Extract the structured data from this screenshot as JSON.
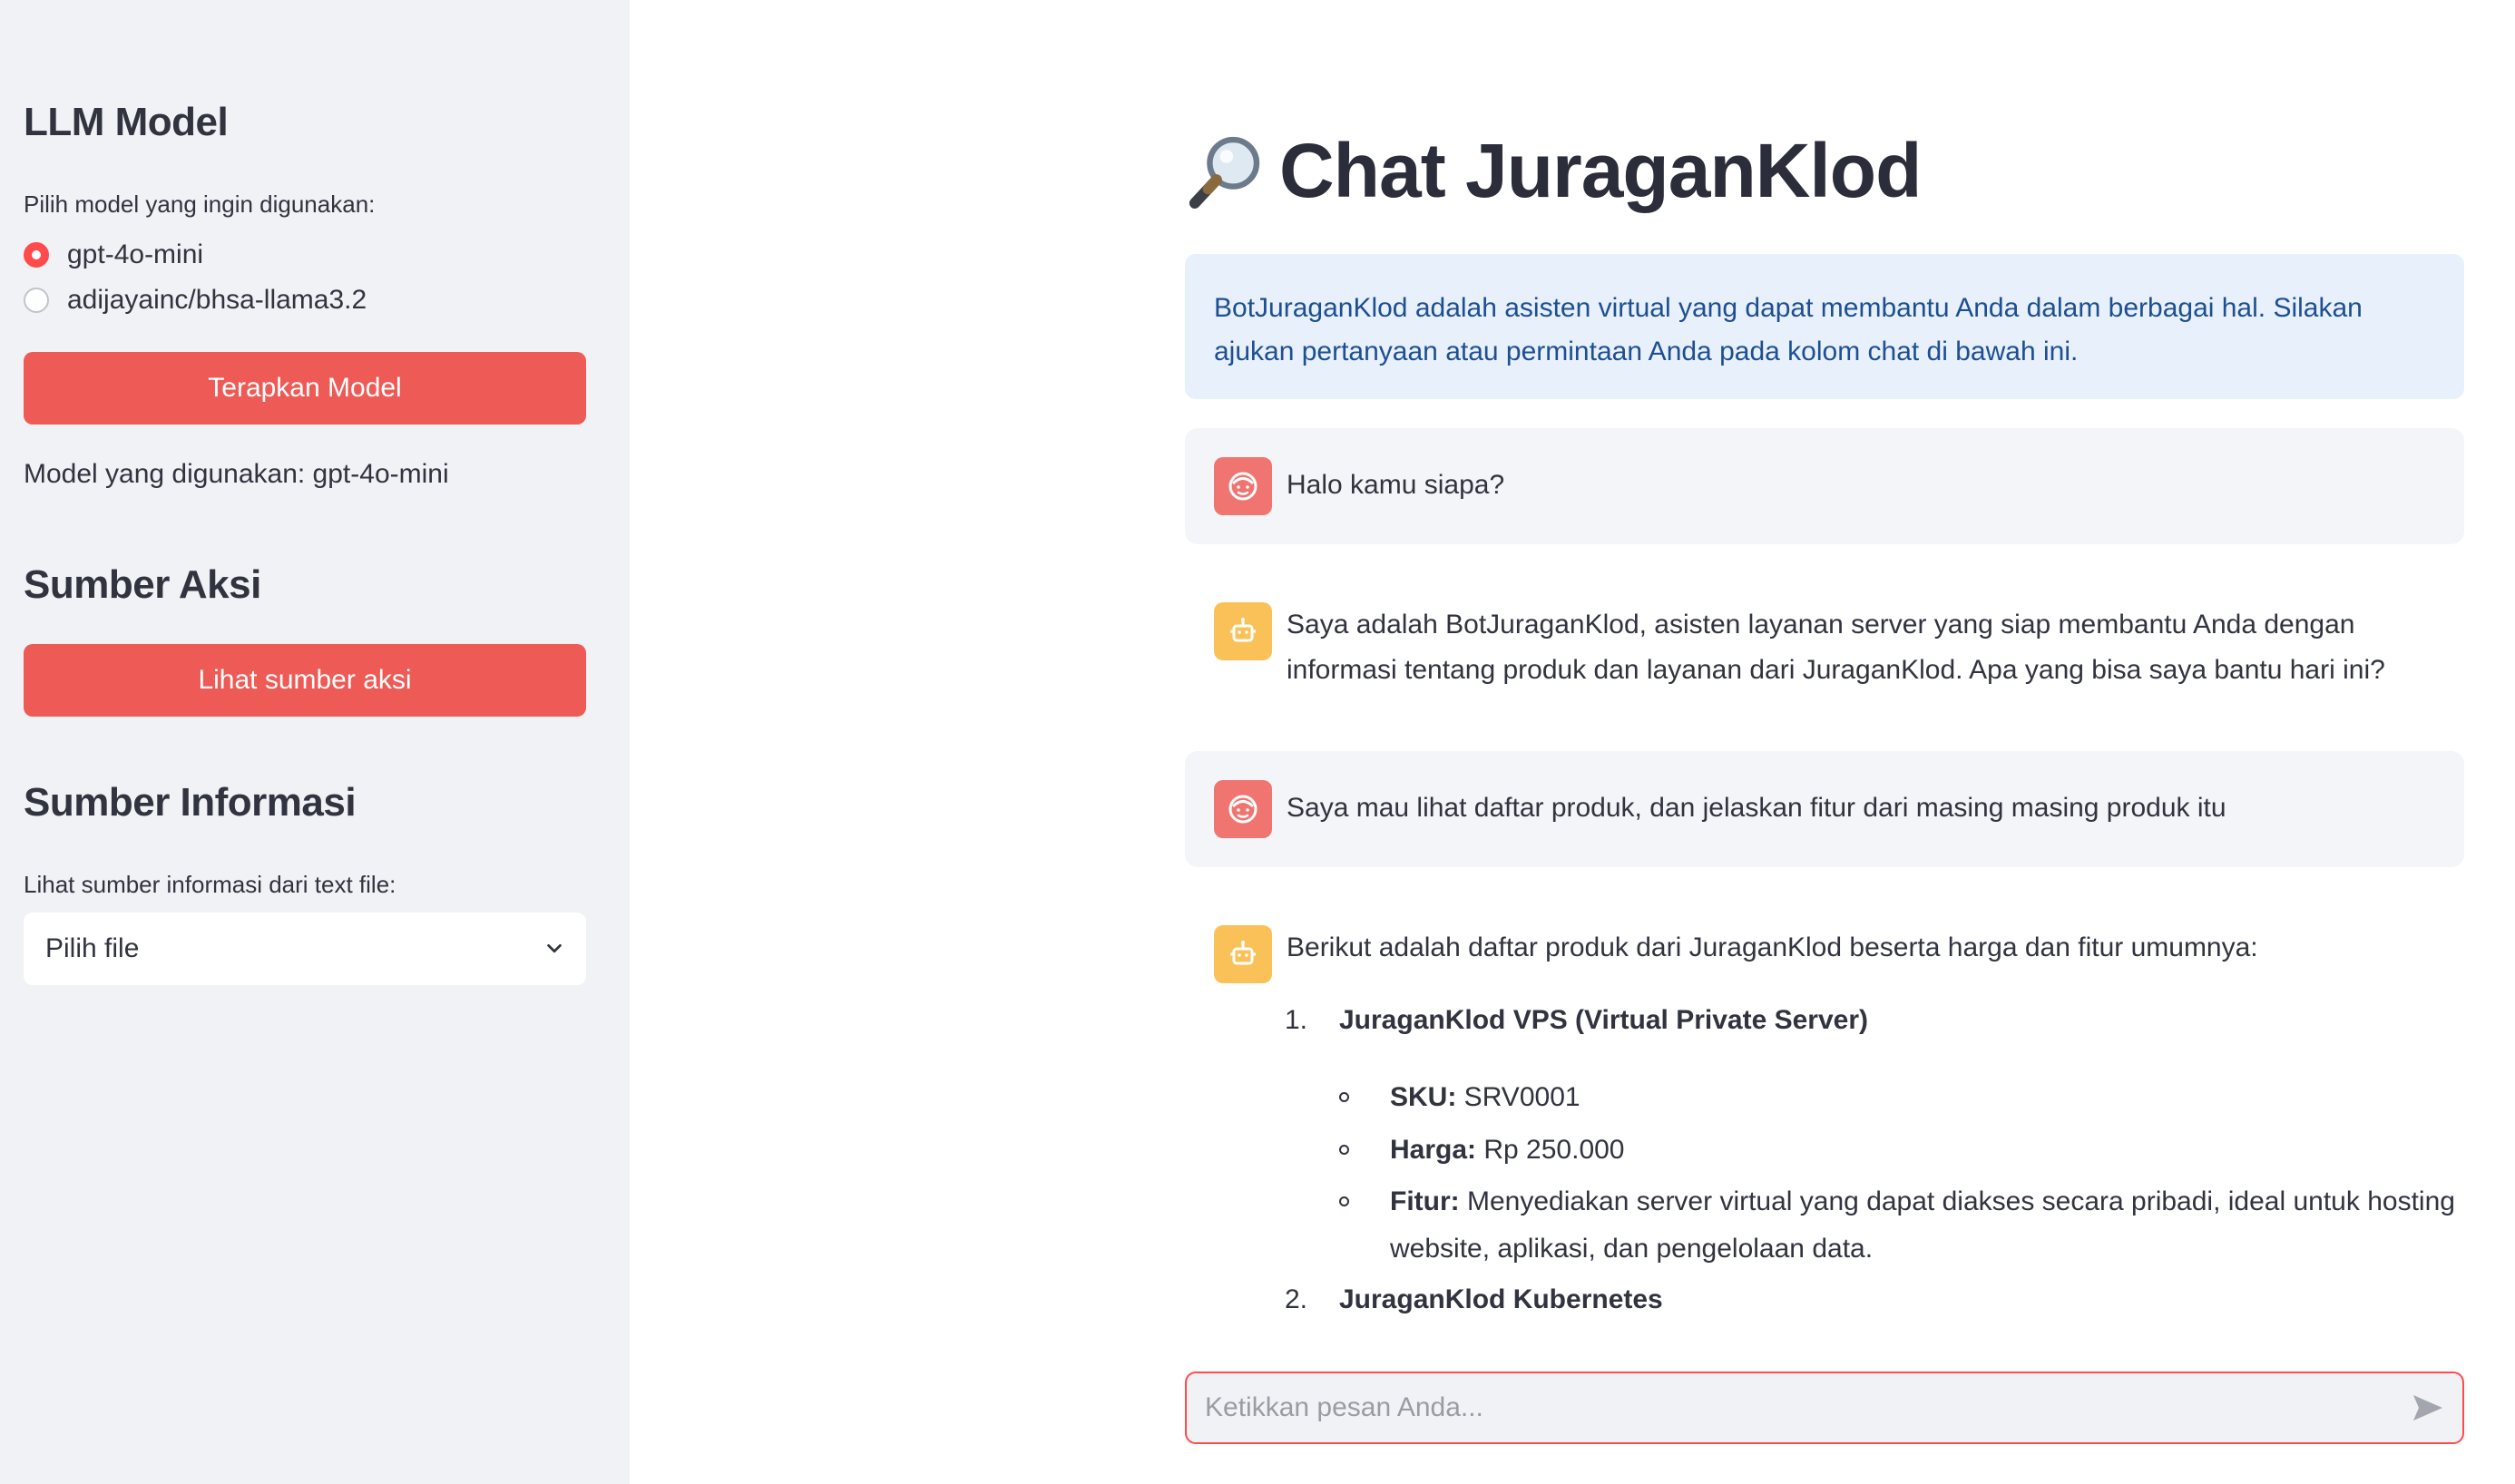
{
  "sidebar": {
    "llm_heading": "LLM Model",
    "model_prompt": "Pilih model yang ingin digunakan:",
    "models": [
      {
        "label": "gpt-4o-mini",
        "selected": true
      },
      {
        "label": "adijayainc/bhsa-llama3.2",
        "selected": false
      }
    ],
    "apply_button": "Terapkan Model",
    "current_model": "Model yang digunakan: gpt-4o-mini",
    "action_heading": "Sumber Aksi",
    "action_button": "Lihat sumber aksi",
    "info_heading": "Sumber Informasi",
    "file_prompt": "Lihat sumber informasi dari text file:",
    "file_select_value": "Pilih file"
  },
  "main": {
    "title_icon": "magnifier-icon",
    "title": "Chat JuraganKlod",
    "info_text": "BotJuraganKlod adalah asisten virtual yang dapat membantu Anda dalam berbagai hal. Silakan ajukan pertanyaan atau permintaan Anda pada kolom chat di bawah ini.",
    "messages": [
      {
        "role": "user",
        "text": "Halo kamu siapa?"
      },
      {
        "role": "assistant",
        "text": "Saya adalah BotJuraganKlod, asisten layanan server yang siap membantu Anda dengan informasi tentang produk dan layanan dari JuraganKlod. Apa yang bisa saya bantu hari ini?"
      },
      {
        "role": "user",
        "text": "Saya mau lihat daftar produk, dan jelaskan fitur dari masing masing produk itu"
      },
      {
        "role": "assistant",
        "text": "Berikut adalah daftar produk dari JuraganKlod beserta harga dan fitur umumnya:",
        "products": [
          {
            "number": "1.",
            "name": "JuraganKlod VPS (Virtual Private Server)",
            "details": [
              {
                "label": "SKU:",
                "value": " SRV0001"
              },
              {
                "label": "Harga:",
                "value": " Rp 250.000"
              },
              {
                "label": "Fitur:",
                "value": " Menyediakan server virtual yang dapat diakses secara pribadi, ideal untuk hosting website, aplikasi, dan pengelolaan data."
              }
            ]
          },
          {
            "number": "2.",
            "name": "JuraganKlod Kubernetes",
            "details": []
          }
        ]
      }
    ],
    "input_placeholder": "Ketikkan pesan Anda..."
  },
  "colors": {
    "accent": "#ff4b4b",
    "button": "#ee5a55",
    "user_avatar": "#f07470",
    "bot_avatar": "#fbc159",
    "info_bg": "#e8f0fb",
    "info_text": "#1d4f91",
    "sidebar_bg": "#f0f2f6"
  }
}
